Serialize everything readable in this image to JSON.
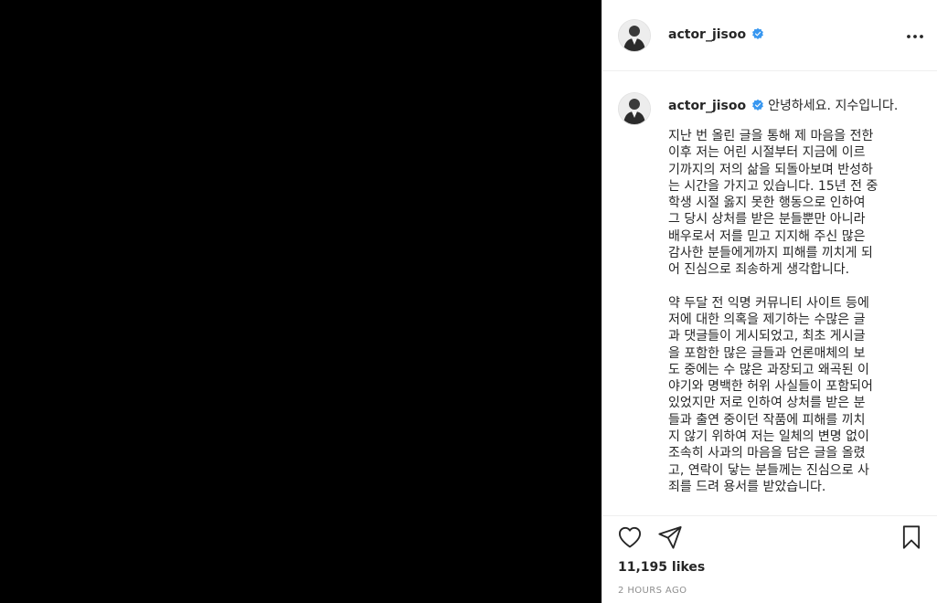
{
  "post": {
    "username": "actor_jisoo",
    "verified": true,
    "avatar_icon": "profile-photo",
    "more_icon": "more-options-icon"
  },
  "caption": {
    "username": "actor_jisoo",
    "greeting": "안녕하세요. 지수입니다.",
    "paragraphs": [
      {
        "lines": [
          "지난 번 올린 글을 통해 제 마음을 전한",
          "이후 저는 어린 시절부터 지금에 이르",
          "기까지의 저의 삶을 되돌아보며 반성하",
          "는 시간을 가지고 있습니다. 15년 전 중",
          "학생 시절 옳지 못한 행동으로 인하여",
          "그 당시 상처를 받은 분들뿐만 아니라",
          "배우로서 저를 믿고 지지해 주신 많은",
          "감사한 분들에게까지 피해를 끼치게 되",
          "어 진심으로 죄송하게 생각합니다."
        ]
      },
      {
        "lines": [
          "약 두달 전 익명 커뮤니티 사이트 등에",
          "저에 대한 의혹을 제기하는 수많은 글",
          "과 댓글들이 게시되었고, 최초 게시글",
          "을 포함한 많은 글들과 언론매체의 보",
          "도 중에는 수 많은 과장되고 왜곡된 이",
          "야기와 명백한 허위 사실들이 포함되어",
          "있었지만 저로 인하여 상처를 받은 분",
          "들과 출연 중이던 작품에 피해를 끼치",
          "지 않기 위하여 저는 일체의 변명 없이",
          "조속히 사과의 마음을 담은 글을 올렸",
          "고, 연락이 닿는 분들께는 진심으로 사",
          "죄를 드려 용서를 받았습니다."
        ]
      }
    ]
  },
  "actions": {
    "like_icon": "heart-icon",
    "share_icon": "send-icon",
    "save_icon": "bookmark-icon",
    "likes": "11,195 likes",
    "timestamp": "2 HOURS AGO"
  },
  "colors": {
    "verified": "#3897f0",
    "text": "#262626",
    "muted": "#8e8e8e",
    "border": "#efefef"
  }
}
